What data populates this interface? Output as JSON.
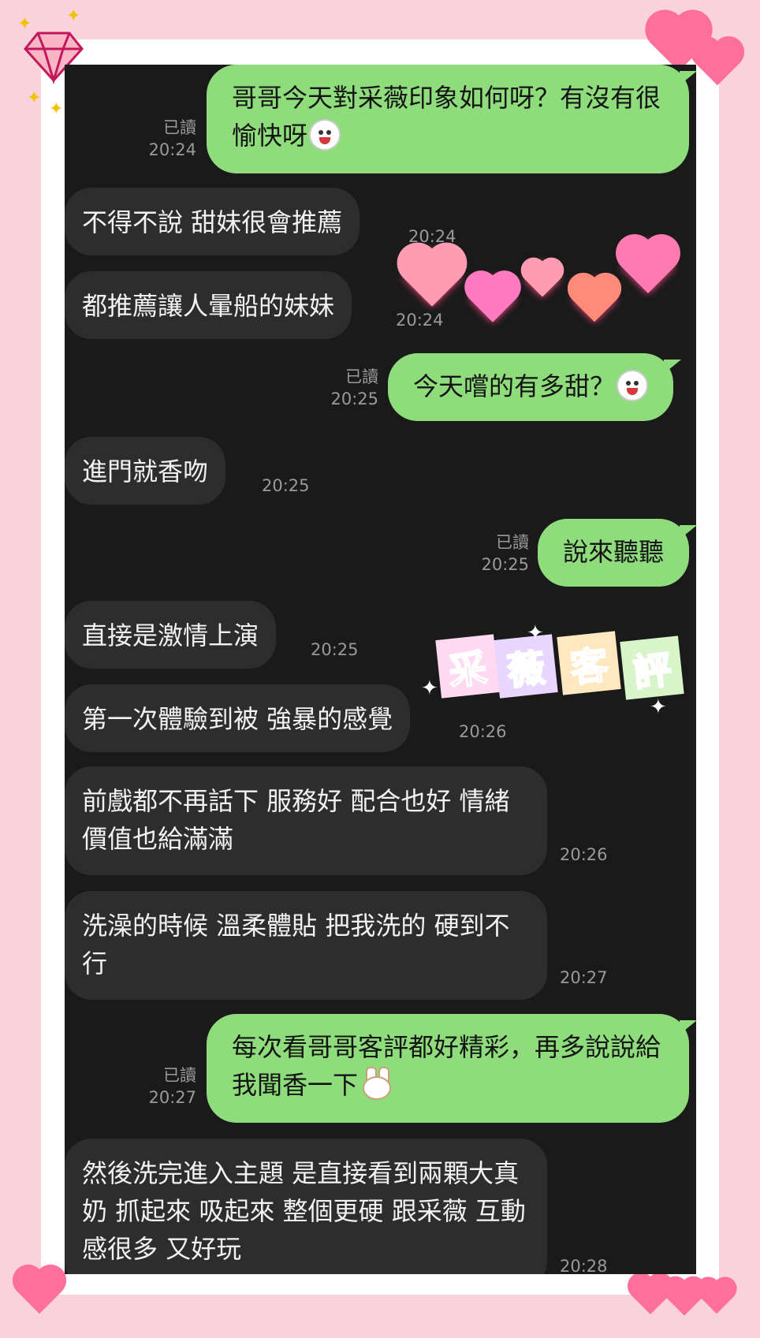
{
  "messages": [
    {
      "side": "out",
      "text": "哥哥今天對采薇印象如何呀？有沒有很愉快呀",
      "status": "已讀",
      "time": "20:24"
    },
    {
      "side": "in",
      "text": "不得不說 甜妹很會推薦",
      "time": "20:24"
    },
    {
      "side": "in",
      "text": "都推薦讓人暈船的妹妹",
      "time": "20:24"
    },
    {
      "side": "out",
      "text": "今天嚐的有多甜？",
      "status": "已讀",
      "time": "20:25"
    },
    {
      "side": "in",
      "text": "進門就香吻",
      "time": "20:25"
    },
    {
      "side": "out",
      "text": "說來聽聽",
      "status": "已讀",
      "time": "20:25"
    },
    {
      "side": "in",
      "text": "直接是激情上演",
      "time": "20:25"
    },
    {
      "side": "in",
      "text": "第一次體驗到被 強暴的感覺",
      "time": "20:26"
    },
    {
      "side": "in",
      "text": "前戲都不再話下 服務好 配合也好 情緒價值也給滿滿",
      "time": "20:26"
    },
    {
      "side": "in",
      "text": "洗澡的時候 溫柔體貼 把我洗的 硬到不行",
      "time": "20:27"
    },
    {
      "side": "out",
      "text": "每次看哥哥客評都好精彩，再多說說給我聞香一下",
      "status": "已讀",
      "time": "20:27"
    },
    {
      "side": "in",
      "text": "然後洗完進入主題 是直接看到兩顆大真奶 抓起來 吸起來 整個更硬 跟采薇 互動感很多 又好玩",
      "time": "20:28"
    }
  ],
  "sticker": {
    "chars": [
      "采",
      "薇",
      "客",
      "評"
    ],
    "colors": [
      "#e23a9a",
      "#9b5ad6",
      "#f39a2b",
      "#4aae3b"
    ]
  },
  "emoji_icons": [
    "laughing-face-icon",
    "smirk-face-icon",
    "rabbit-face-icon"
  ],
  "colors": {
    "outgoing_bubble": "#8fdc7d",
    "incoming_bubble": "#2d2d2d",
    "chat_bg": "#1a1a1a",
    "page_bg": "#f9d3dc"
  }
}
